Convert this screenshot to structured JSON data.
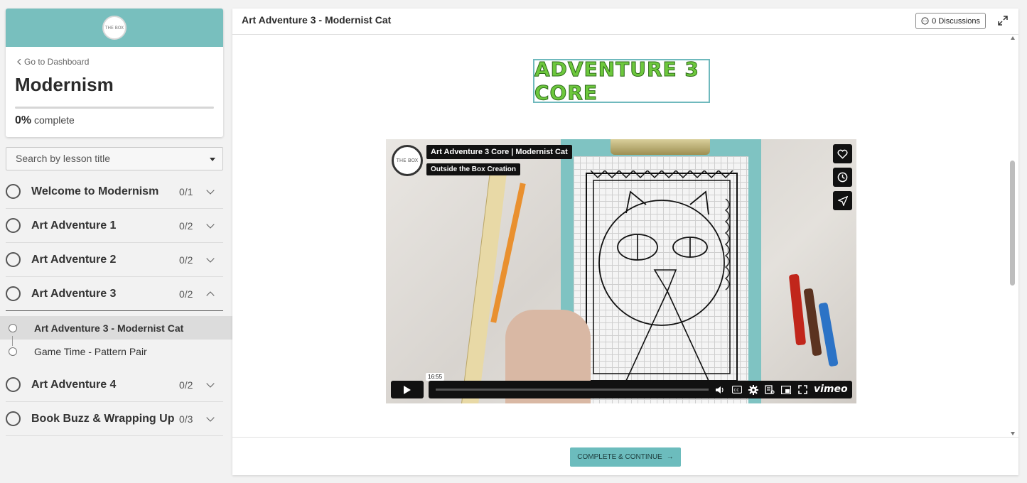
{
  "course": {
    "logo_text": "THE BOX",
    "back_label": "Go to Dashboard",
    "title": "Modernism",
    "progress_percent": "0%",
    "progress_suffix": "complete",
    "progress_value": 0
  },
  "search": {
    "placeholder": "Search by lesson title"
  },
  "sections": [
    {
      "title": "Welcome to Modernism",
      "count": "0/1",
      "expanded": false
    },
    {
      "title": "Art Adventure 1",
      "count": "0/2",
      "expanded": false
    },
    {
      "title": "Art Adventure 2",
      "count": "0/2",
      "expanded": false
    },
    {
      "title": "Art Adventure 3",
      "count": "0/2",
      "expanded": true
    },
    {
      "title": "Art Adventure 4",
      "count": "0/2",
      "expanded": false
    },
    {
      "title": "Book Buzz & Wrapping Up",
      "count": "0/3",
      "expanded": false
    }
  ],
  "lessons": [
    {
      "title": "Art Adventure 3 - Modernist Cat",
      "active": true
    },
    {
      "title": "Game Time - Pattern Pair",
      "active": false
    }
  ],
  "main": {
    "title": "Art Adventure 3 - Modernist Cat",
    "discussions_label": "0 Discussions",
    "banner_text": "ADVENTURE 3 CORE"
  },
  "video": {
    "channel_logo_text": "THE BOX",
    "title": "Art Adventure 3 Core | Modernist Cat",
    "channel": "Outside the Box Creation",
    "time_bubble": "16:55",
    "brand": "vimeo",
    "icons": [
      "heart-icon",
      "clock-icon",
      "send-icon",
      "play-icon",
      "volume-icon",
      "cc-icon",
      "gear-icon",
      "chapters-icon",
      "pip-icon",
      "fullscreen-icon"
    ]
  },
  "footer": {
    "complete_label": "COMPLETE & CONTINUE",
    "arrow": "→"
  },
  "colors": {
    "accent": "#78bfbe",
    "button": "#6cbcbd",
    "banner_green": "#6dc83d"
  }
}
